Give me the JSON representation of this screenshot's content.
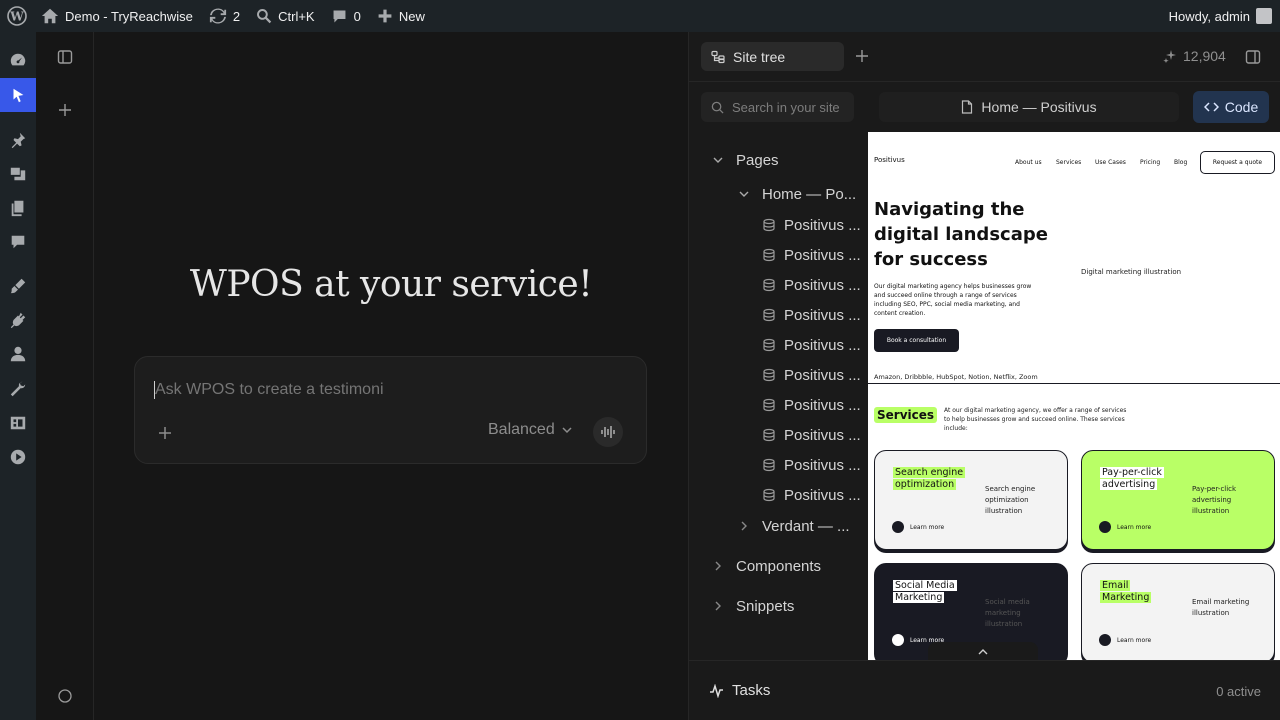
{
  "admin_bar": {
    "site_name": "Demo - TryReachwise",
    "updates_count": "2",
    "search_shortcut": "Ctrl+K",
    "comments_count": "0",
    "new_label": "New",
    "greeting": "Howdy, admin"
  },
  "wp_menu": {
    "items": [
      "dashboard-icon",
      "wpos-icon",
      "pin-icon",
      "media-icon",
      "pages-icon",
      "comments-icon",
      "appearance-icon",
      "plugins-icon",
      "users-icon",
      "tools-icon",
      "settings-icon",
      "play-icon"
    ]
  },
  "chat": {
    "title": "WPOS at your service!",
    "prompt_placeholder": "Ask WPOS to create a testimoni",
    "mode_label": "Balanced"
  },
  "panel": {
    "site_tree_tab": "Site tree",
    "token_count": "12,904",
    "search_placeholder": "Search in your site",
    "preview_page": "Home — Positivus",
    "code_button": "Code",
    "tree": {
      "pages_label": "Pages",
      "home_label": "Home — Po...",
      "sub_items": [
        "Positivus ...",
        "Positivus ...",
        "Positivus ...",
        "Positivus ...",
        "Positivus ...",
        "Positivus ...",
        "Positivus ...",
        "Positivus ...",
        "Positivus ...",
        "Positivus ..."
      ],
      "verdant_label": "Verdant — ...",
      "components_label": "Components",
      "snippets_label": "Snippets"
    },
    "tasks_label": "Tasks",
    "tasks_status": "0 active"
  },
  "site_preview": {
    "logo_alt": "Positivus",
    "nav": [
      "About us",
      "Services",
      "Use Cases",
      "Pricing",
      "Blog"
    ],
    "quote_button": "Request a quote",
    "hero_title": "Navigating the digital landscape for success",
    "hero_text": "Our digital marketing agency helps businesses grow and succeed online through a range of services including SEO, PPC, social media marketing, and content creation.",
    "hero_cta": "Book a consultation",
    "hero_image_alt": "Digital marketing illustration",
    "logos_alt": "Amazon, Dribbble, HubSpot, Notion, Netflix, Zoom",
    "services_heading": "Services",
    "services_text": "At our digital marketing agency, we offer a range of services to help businesses grow and succeed online. These services include:",
    "learn_more": "Learn more",
    "cards": [
      {
        "title_line1": "Search engine",
        "title_line2": "optimization",
        "image_alt": "Search engine optimization illustration"
      },
      {
        "title_line1": "Pay-per-click",
        "title_line2": "advertising",
        "image_alt": "Pay-per-click advertising illustration"
      },
      {
        "title_line1": "Social Media",
        "title_line2": "Marketing",
        "image_alt": "Social media marketing illustration"
      },
      {
        "title_line1": "Email",
        "title_line2": "Marketing",
        "image_alt": "Email marketing illustration"
      }
    ]
  },
  "colors": {
    "accent": "#3858e9",
    "lime": "#b9ff66",
    "dark": "#191a23"
  }
}
